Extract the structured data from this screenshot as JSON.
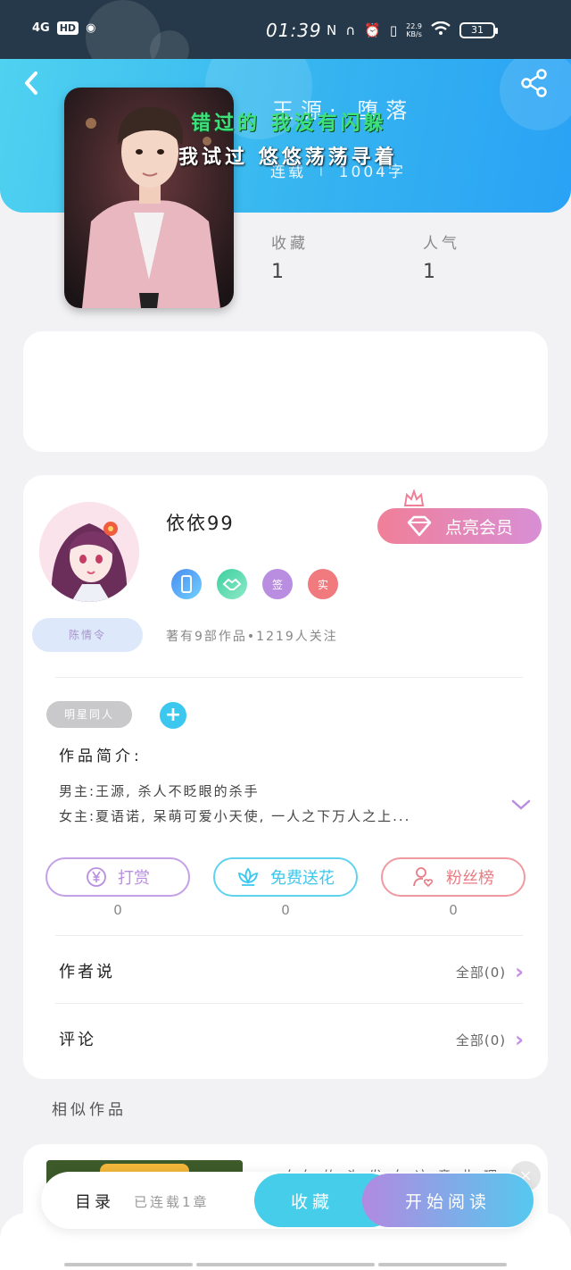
{
  "status_bar": {
    "network": "4G",
    "hd": "HD",
    "time": "01:39",
    "speed_value": "22.9",
    "speed_unit": "KB/s",
    "battery": "31"
  },
  "header": {
    "book_title": "王源· 堕落",
    "status": "连载",
    "word_count": "1004字"
  },
  "cover": {
    "lyric_line1": "错过的 我没有闪躲",
    "lyric_line2": "我试过 悠悠荡荡寻着"
  },
  "stats": {
    "favorites_label": "收藏",
    "favorites_value": "1",
    "popularity_label": "人气",
    "popularity_value": "1"
  },
  "author": {
    "name": "依依99",
    "badge_name": "陈情令",
    "vip_label": "点亮会员",
    "badges": [
      "",
      "",
      "签",
      "实"
    ],
    "meta": "著有9部作品•1219人关注"
  },
  "tags": {
    "tag1": "明星同人",
    "add_label": "+"
  },
  "intro": {
    "title": "作品简介:",
    "line1": "男主:王源,  杀人不眨眼的杀手",
    "line2": "女主:夏语诺, 呆萌可爱小天使, 一人之下万人之上..."
  },
  "actions": {
    "reward_label": "打赏",
    "reward_count": "0",
    "flower_label": "免费送花",
    "flower_count": "0",
    "fans_label": "粉丝榜",
    "fans_count": "0"
  },
  "rows": {
    "author_says": "作者说",
    "author_says_all": "全部(0)",
    "comments": "评论",
    "comments_all": "全部(0)"
  },
  "similar": {
    "title": "相似作品",
    "text": "女女 的 头 发 女 这 意 此 理"
  },
  "bottom": {
    "toc_label": "目录",
    "toc_status": "已连载1章",
    "fav_label": "收藏",
    "read_label": "开始阅读"
  },
  "colors": {
    "header_blue": "#35b4f0",
    "accent_cyan": "#46cdea",
    "vip_pink": "#f07f98",
    "reward_purple": "#b98ee0",
    "fans_red": "#e87c84"
  }
}
